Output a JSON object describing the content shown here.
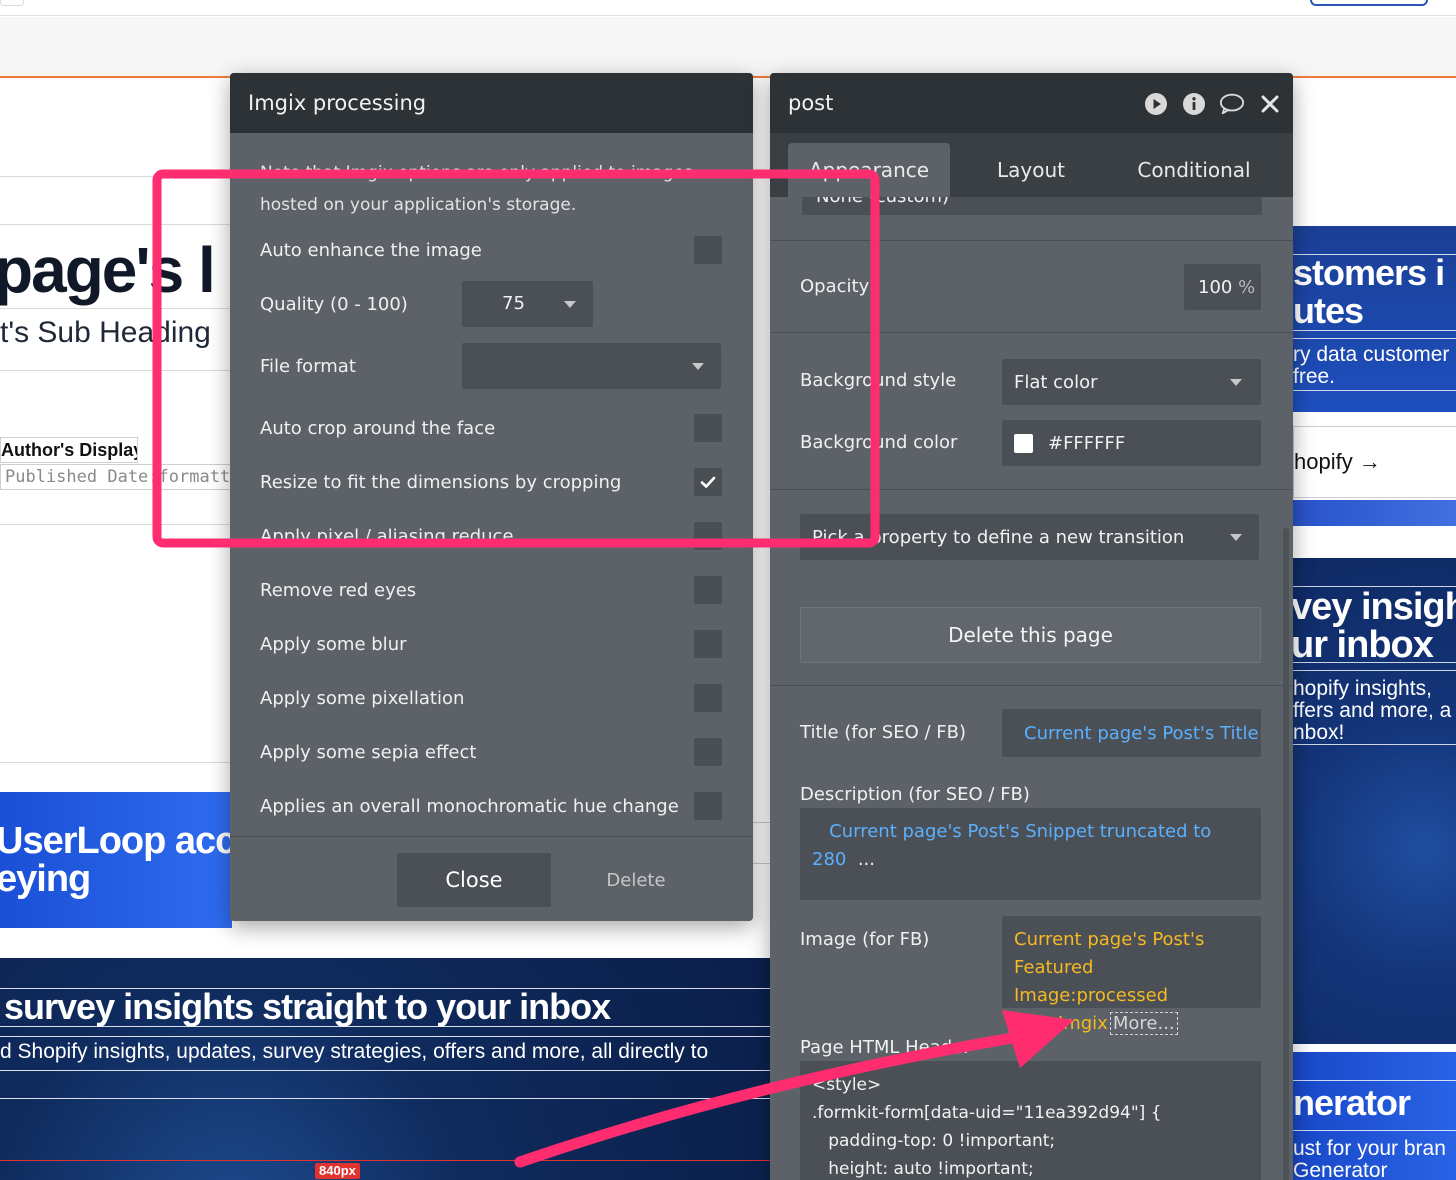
{
  "colors": {
    "annotation": "#ff2d6f",
    "panel_bg": "#5c6268",
    "panel_head": "#2d3236",
    "dynamic_blue": "#5ab0ff",
    "dynamic_yellow": "#f5b921"
  },
  "background": {
    "hero_title": "page's l",
    "hero_subtitle": "t's Sub Heading",
    "author_display": "Author's Display",
    "published": "Published Date:formatted",
    "blue_banner": "UserLoop acco\neying",
    "navy_heading": "survey insights straight to your inbox",
    "navy_text": "d Shopify insights, updates, survey strategies, offers and more, all directly to",
    "width_badge": "840px",
    "right_card_1_heading": "stomers i\nutes",
    "right_card_1_text": "ry data customer\nfree.",
    "right_shopify_link": "hopify →",
    "right_card_2_heading": "vey insigh\nur inbox",
    "right_card_2_text": "hopify insights,\nffers and more, a\nnbox!",
    "right_card_3_heading": "nerator",
    "right_card_3_text": "ust for your bran\nGenerator"
  },
  "imgix": {
    "title": "Imgix processing",
    "note": "Note that Imgix options are only applied to images hosted on your application's storage.",
    "options": [
      {
        "label": "Auto enhance the image",
        "checked": false
      },
      {
        "label": "Auto crop around the face",
        "checked": false
      },
      {
        "label": "Resize to fit the dimensions by cropping",
        "checked": true
      },
      {
        "label": "Apply pixel / aliasing reduce",
        "checked": false
      },
      {
        "label": "Remove red eyes",
        "checked": false
      },
      {
        "label": "Apply some blur",
        "checked": false
      },
      {
        "label": "Apply some pixellation",
        "checked": false
      },
      {
        "label": "Apply some sepia effect",
        "checked": false
      },
      {
        "label": "Applies an overall monochromatic hue change",
        "checked": false
      }
    ],
    "quality_label": "Quality (0 - 100)",
    "quality_value": "75",
    "file_format_label": "File format",
    "file_format_value": "",
    "close_label": "Close",
    "delete_label": "Delete"
  },
  "post": {
    "title": "post",
    "icons": [
      "play-icon",
      "info-icon",
      "comment-icon",
      "close-icon"
    ],
    "tabs": [
      "Appearance",
      "Layout",
      "Conditional"
    ],
    "active_tab": "Appearance",
    "top_select": "None (custom)",
    "opacity_label": "Opacity",
    "opacity_value": "100",
    "opacity_unit": "%",
    "bg_style_label": "Background style",
    "bg_style_value": "Flat color",
    "bg_color_label": "Background color",
    "bg_color_value": "#FFFFFF",
    "transition_placeholder": "Pick a property to define a new transition",
    "delete_page_label": "Delete this page",
    "seo_title_label": "Title (for SEO / FB)",
    "seo_title_value": "Current page's Post's Title",
    "seo_desc_label": "Description (for SEO / FB)",
    "seo_desc_value_1": "Current page's Post's Snippet truncated to",
    "seo_desc_value_2": "280",
    "seo_desc_value_3": "...",
    "image_label": "Image (for FB)",
    "image_value_1": "Current page's Post's",
    "image_value_2": "Featured Image:processed",
    "image_value_3": "with Imgix",
    "image_more": "More...",
    "html_header_label": "Page HTML Header",
    "html_header_code": "<style>\n.formkit-form[data-uid=\"11ea392d94\"] {\n   padding-top: 0 !important;\n   height: auto !important;"
  }
}
